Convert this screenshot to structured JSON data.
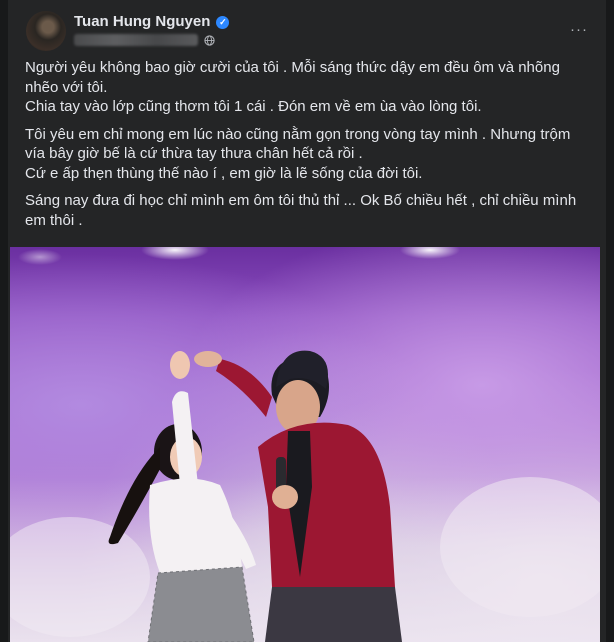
{
  "post": {
    "author": "Tuan Hung Nguyen",
    "more_label": "···",
    "paragraphs": [
      [
        "Người yêu không bao giờ cười của tôi . Mỗi sáng thức dậy em đều ôm và nhõng nhẽo với tôi.",
        "Chia tay vào lớp cũng thơm tôi 1 cái . Đón em về em ùa vào lòng tôi."
      ],
      [
        "Tôi yêu em chỉ mong em lúc nào cũng nằm gọn trong vòng tay mình . Nhưng trộm vía bây giờ bế là cứ thừa tay thưa chân hết cả rồi .",
        "Cứ e ấp thẹn thùng thế nào í , em giờ là lẽ sống của đời tôi."
      ],
      [
        "Sáng nay đưa đi học chỉ mình em ôm tôi thủ thỉ ... Ok Bố chiều hết , chỉ chiều mình em thôi ."
      ]
    ]
  },
  "icons": {
    "verified": "verified-badge-icon",
    "privacy": "globe-icon",
    "more": "more-options-icon"
  },
  "colors": {
    "background": "#18191a",
    "card": "#242526",
    "text": "#e4e6eb",
    "secondary": "#b0b3b8",
    "verified": "#2d88ff"
  }
}
